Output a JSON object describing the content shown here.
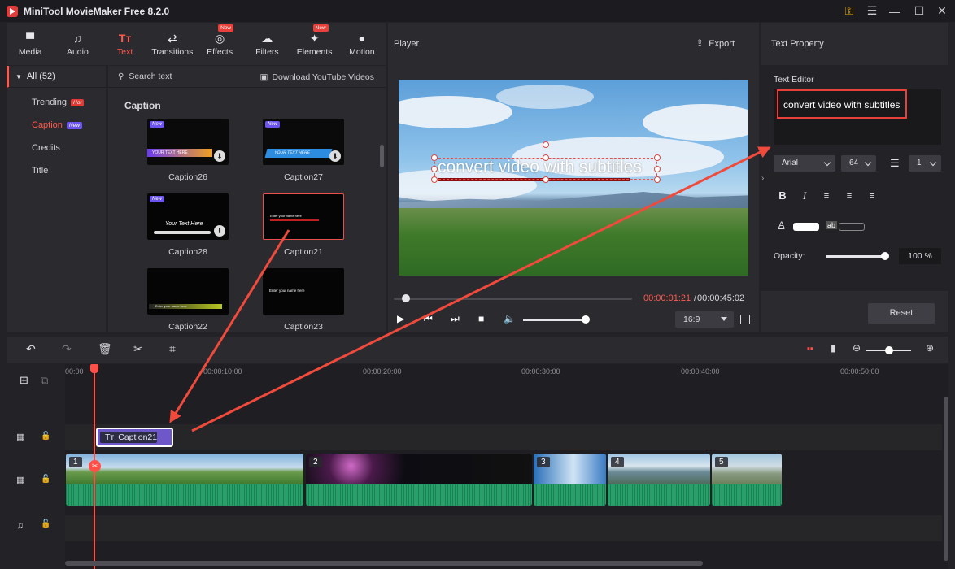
{
  "app": {
    "title": "MiniTool MovieMaker Free 8.2.0"
  },
  "window_icons": [
    "key-icon",
    "menu-icon",
    "minimize-icon",
    "maximize-icon",
    "close-icon"
  ],
  "toolbar": {
    "items": [
      {
        "label": "Media",
        "icon": "▀"
      },
      {
        "label": "Audio",
        "icon": "♫"
      },
      {
        "label": "Text",
        "icon": "Tт"
      },
      {
        "label": "Transitions",
        "icon": "⇄"
      },
      {
        "label": "Effects",
        "icon": "◎",
        "new": "New"
      },
      {
        "label": "Filters",
        "icon": "☁"
      },
      {
        "label": "Elements",
        "icon": "✦",
        "new": "New"
      },
      {
        "label": "Motion",
        "icon": "●"
      }
    ]
  },
  "nav": {
    "all": "All (52)",
    "items": [
      {
        "label": "Trending",
        "badge": "Hot"
      },
      {
        "label": "Caption",
        "badge": "New"
      },
      {
        "label": "Credits"
      },
      {
        "label": "Title"
      }
    ]
  },
  "library": {
    "search": "Search text",
    "youtube": "Download YouTube Videos",
    "section": "Caption",
    "items": [
      {
        "label": "Caption26",
        "new": "New",
        "preview": "YOUR TEXT HERE"
      },
      {
        "label": "Caption27",
        "new": "New",
        "preview": "YOUR TEXT HERE"
      },
      {
        "label": "Caption28",
        "new": "New",
        "preview": "Your Text Here"
      },
      {
        "label": "Caption21",
        "preview": "Enter your name here"
      },
      {
        "label": "Caption22",
        "preview": "Enter your name here"
      },
      {
        "label": "Caption23",
        "preview": "Enter your name here"
      }
    ]
  },
  "player": {
    "title": "Player",
    "export": "Export",
    "overlay_text": "convert video with subtitles",
    "time_current": "00:00:01:21",
    "time_sep": "/",
    "time_total": "00:00:45:02",
    "ratio": "16:9",
    "progress": 0.03,
    "volume": 0.95
  },
  "text_property": {
    "title": "Text Property",
    "editor_label": "Text Editor",
    "editor_value": "convert video with subtitles",
    "font": "Arial",
    "size": "64",
    "line_spacing": "1",
    "format_buttons": [
      "B",
      "I",
      "align-left",
      "align-center",
      "align-right"
    ],
    "opacity_label": "Opacity:",
    "opacity_value": "100 %",
    "reset": "Reset",
    "text_color": "#ffffff"
  },
  "timeline": {
    "ticks": [
      "00:00",
      "00:00:10:00",
      "00:00:20:00",
      "00:00:30:00",
      "00:00:40:00",
      "00:00:50:00"
    ],
    "caption_clip": "Caption21",
    "clips": [
      "1",
      "2",
      "3",
      "4",
      "5"
    ]
  },
  "colors": {
    "accent": "#ff5a4f",
    "audio": "#27a06a",
    "caption_clip": "#6e57c9"
  }
}
